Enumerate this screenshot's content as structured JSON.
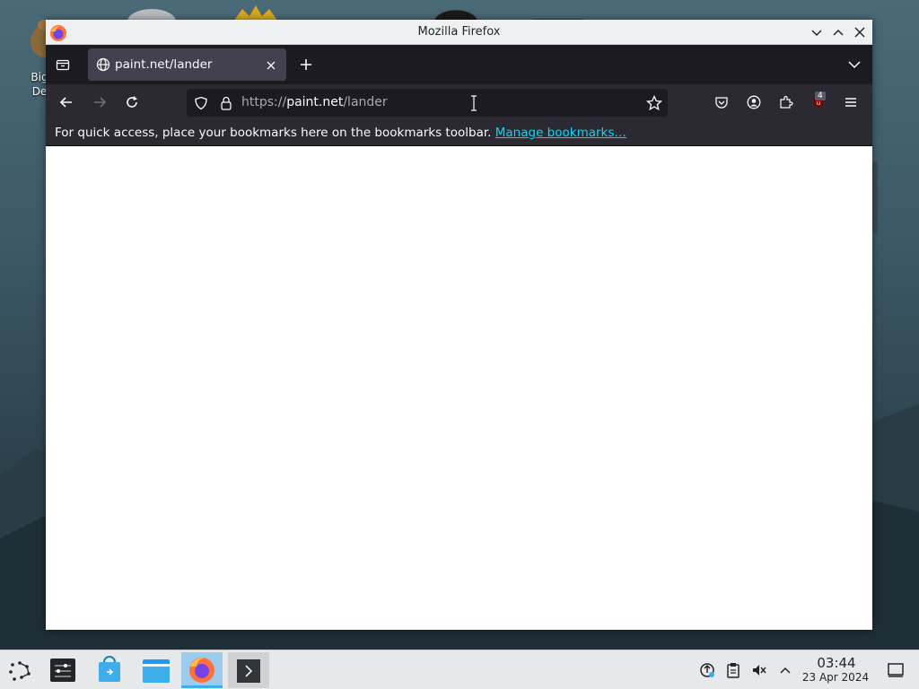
{
  "desktop": {
    "icon_label": "Big\nDe"
  },
  "window": {
    "title": "Mozilla Firefox"
  },
  "tabs": [
    {
      "title": "paint.net/lander",
      "active": true
    }
  ],
  "navbar": {
    "url_prefix": "https://",
    "url_host": "paint.net",
    "url_path": "/lander",
    "extension_badge": "4"
  },
  "bookmarks_toolbar": {
    "message": "For quick access, place your bookmarks here on the bookmarks toolbar.",
    "link": "Manage bookmarks…"
  },
  "taskbar": {
    "time": "03:44",
    "date": "23 Apr 2024"
  },
  "colors": {
    "accent": "#3daee9",
    "link": "#00ddff",
    "tab_bg": "#42414d",
    "toolbar_bg": "#2b2a33"
  }
}
